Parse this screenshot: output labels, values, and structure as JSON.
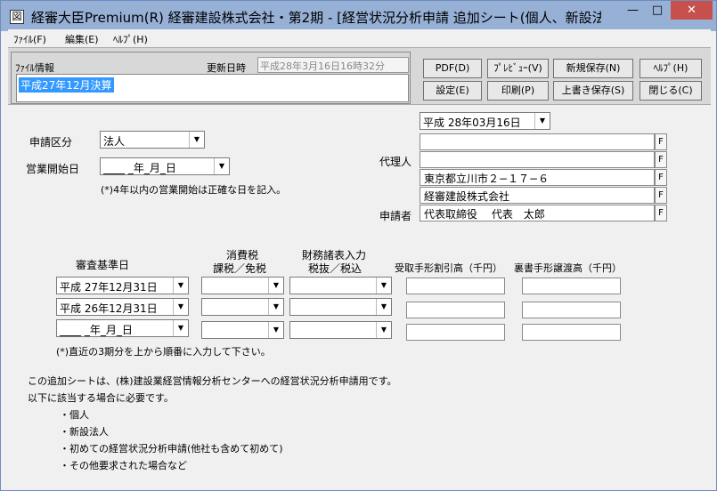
{
  "window": {
    "app_icon": "図",
    "title": "経審大臣Premium(R)  経審建設株式会社・第2期 - [経営状況分析申請  追加シート(個人、新設法...",
    "minimize": "—",
    "maximize": "□",
    "close": "✕"
  },
  "menu": {
    "file": "ﾌｧｲﾙ(F)",
    "edit": "編集(E)",
    "help": "ﾍﾙﾌﾟ(H)"
  },
  "fileinfo": {
    "label": "ﾌｧｲﾙ情報",
    "updated_label": "更新日時",
    "updated_value": "平成28年3月16日16時32分",
    "name": "平成27年12月決算"
  },
  "toolbar": {
    "pdf": "PDF(D)",
    "preview": "ﾌﾟﾚﾋﾞｭｰ(V)",
    "save_new": "新規保存(N)",
    "help": "ﾍﾙﾌﾟ(H)",
    "settings": "設定(E)",
    "print": "印刷(P)",
    "overwrite": "上書き保存(S)",
    "close": "閉じる(C)"
  },
  "form": {
    "date_select": "平成 28年03月16日",
    "shinsei_label": "申請区分",
    "shinsei_value": "法人",
    "start_label": "営業開始日",
    "start_value": "____ _年_月_日",
    "start_note": "(*)4年以内の営業開始は正確な日を記入。",
    "agent_label": "代理人",
    "applicant_label": "申請者",
    "agent_lines": [
      "",
      "",
      "東京都立川市２−１７−６",
      "経審建設株式会社"
    ],
    "applicant_line": "代表取締役　 代表　太郎",
    "f_btn": "F"
  },
  "table": {
    "h_base": "審査基準日",
    "h_tax1": "消費税",
    "h_tax2": "課税／免税",
    "h_fin1": "財務諸表入力",
    "h_fin2": "税抜／税込",
    "h_discount": "受取手形割引高（千円）",
    "h_endorse": "裏書手形譲渡高（千円）",
    "rows": [
      {
        "date": "平成 27年12月31日"
      },
      {
        "date": "平成 26年12月31日"
      },
      {
        "date": "____ _年_月_日"
      }
    ],
    "note": "(*)直近の3期分を上から順番に入力して下さい。"
  },
  "description": {
    "line1": "この追加シートは、(株)建設業経営情報分析センターへの経営状況分析申請用です。",
    "line2": "以下に該当する場合に必要です。",
    "items": [
      "・個人",
      "・新設法人",
      "・初めての経営状況分析申請(他社も含めて初めて)",
      "・その他要求された場合など"
    ]
  },
  "icons": {
    "dropdown": "▼"
  }
}
